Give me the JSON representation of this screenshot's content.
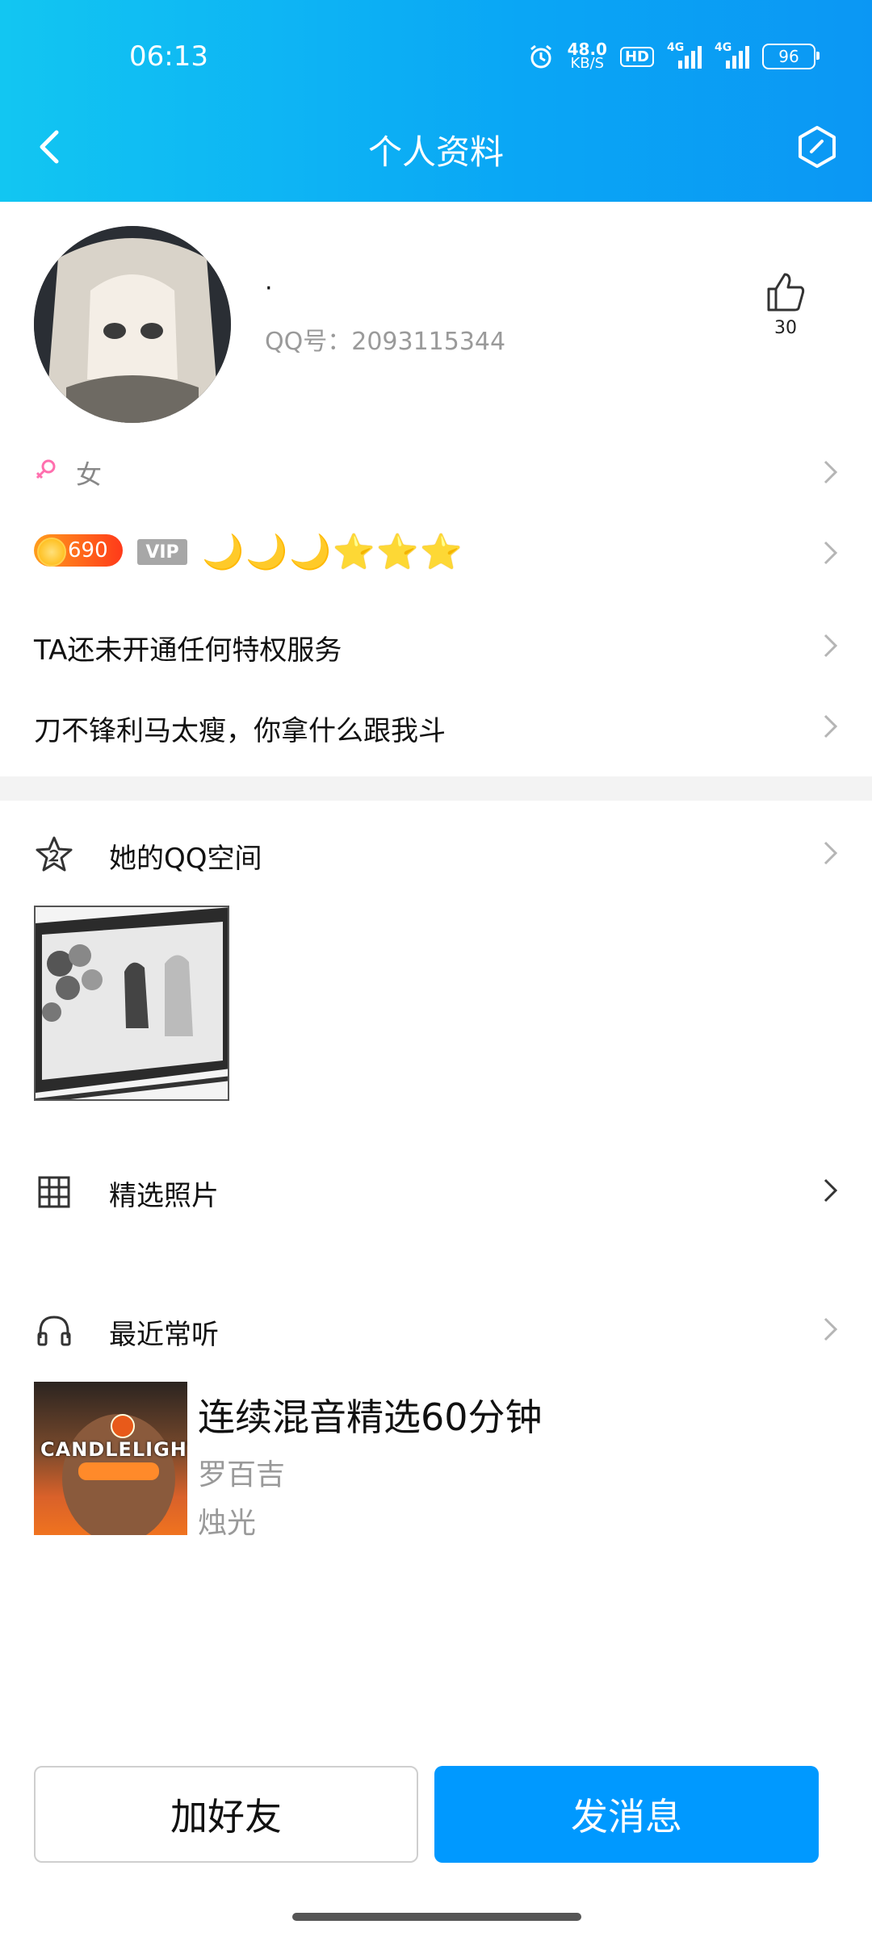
{
  "status_bar": {
    "time": "06:13",
    "speed_value": "48.0",
    "speed_unit": "KB/S",
    "hd_label": "HD",
    "network_1": "4G",
    "network_2": "4G",
    "battery": "96"
  },
  "header": {
    "title": "个人资料",
    "back_icon": "chevron-left-icon",
    "settings_icon": "hexagon-edit-icon"
  },
  "profile": {
    "nickname": "·",
    "qq_number": "QQ号：2093115344",
    "like_count": "30",
    "gender": "女",
    "gender_color": "#ff6fae"
  },
  "level": {
    "coin_value": "690",
    "vip_label": "VIP",
    "icons": [
      "🌙",
      "🌙",
      "🌙",
      "⭐",
      "⭐",
      "⭐"
    ]
  },
  "privilege_text": "TA还未开通任何特权服务",
  "signature": "刀不锋利马太瘦，你拿什么跟我斗",
  "sections": {
    "qzone": "她的QQ空间",
    "photos": "精选照片",
    "music": "最近常听"
  },
  "music": {
    "album_art_text": "CANDLELIGHT",
    "title": "连续混音精选60分钟",
    "artist": "罗百吉",
    "album": "烛光"
  },
  "actions": {
    "add_friend": "加好友",
    "send_message": "发消息"
  },
  "colors": {
    "header_start": "#12c6f2",
    "header_end": "#0b97f4",
    "primary_button": "#0099ff"
  }
}
